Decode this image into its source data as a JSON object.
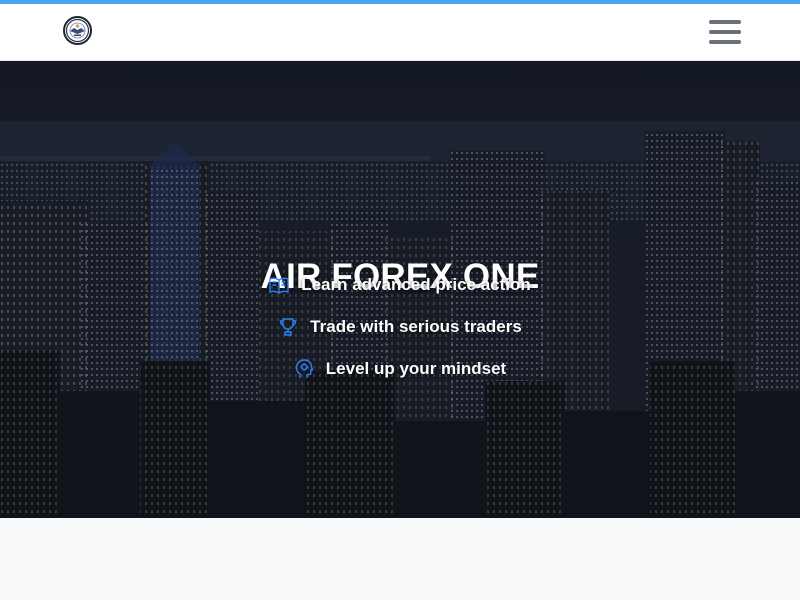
{
  "brand": {
    "title": "AIR FOREX ONE",
    "logo_icon": "logo-emblem-icon"
  },
  "navbar": {
    "menu_icon": "hamburger-menu-icon",
    "background": "#ffffff",
    "accent": "#4aa3f0"
  },
  "hero": {
    "title": "AIR FOREX ONE",
    "background_icon": "city-skyline-night-image",
    "features": [
      {
        "icon": "book-icon",
        "label": "Learn advanced price action"
      },
      {
        "icon": "trophy-icon",
        "label": "Trade with serious traders"
      },
      {
        "icon": "brain-head-icon",
        "label": "Level up your mindset"
      }
    ],
    "icon_color": "#2d7ff9"
  }
}
